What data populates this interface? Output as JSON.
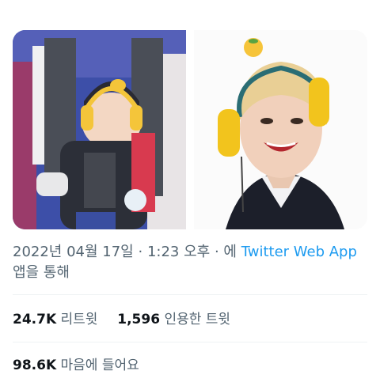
{
  "media": {
    "images": [
      {
        "description_icon": "baby-photo"
      },
      {
        "description_icon": "person-photo"
      }
    ]
  },
  "tweet_meta": {
    "date": "2022년 04월 17일",
    "separator1": "·",
    "time": "1:23 오후",
    "separator2": "·",
    "via_prefix": "에",
    "via_app": "Twitter Web App",
    "via_suffix": "앱을 통해"
  },
  "stats": {
    "retweets_count": "24.7K",
    "retweets_label": "리트윗",
    "quotes_count": "1,596",
    "quotes_label": "인용한 트윗",
    "likes_count": "98.6K",
    "likes_label": "마음에 들어요"
  },
  "colors": {
    "link": "#1d9bf0",
    "muted": "#536471",
    "text": "#0f1419",
    "divider": "#eff3f4"
  }
}
